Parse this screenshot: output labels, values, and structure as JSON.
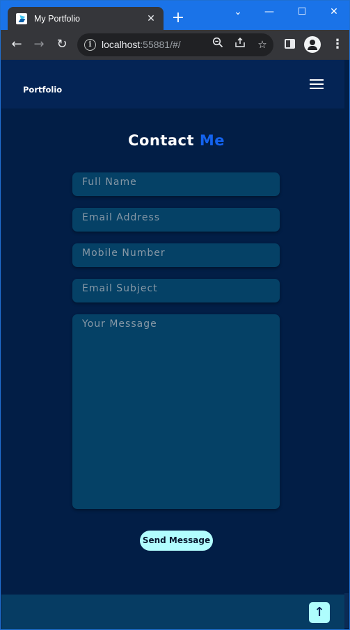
{
  "browser": {
    "tab_title": "My Portfolio",
    "tab_close": "✕",
    "new_tab": "+",
    "window_controls": {
      "dropdown": "⌄",
      "minimize": "—",
      "maximize": "☐",
      "close": "✕"
    },
    "url_host": "localhost",
    "url_rest": ":55881/#/",
    "nav": {
      "back": "←",
      "forward": "→",
      "reload": "↻"
    },
    "icons": {
      "zoom": "zoom-icon",
      "share": "share-icon",
      "bookmark": "star-icon",
      "side_panel": "side-panel-icon",
      "profile": "profile-icon",
      "menu": "kebab-menu-icon"
    }
  },
  "navbar": {
    "brand": "Portfolio"
  },
  "contact": {
    "heading_white": "Contact ",
    "heading_blue": "Me",
    "fields": {
      "full_name": "Full Name",
      "email": "Email Address",
      "mobile": "Mobile Number",
      "subject": "Email Subject",
      "message": "Your Message"
    },
    "send_button": "Send Message"
  },
  "footer": {
    "scroll_top": "↑"
  },
  "colors": {
    "page_bg": "#021e46",
    "navbar_bg": "#042455",
    "field_bg": "#054166",
    "accent_blue": "#1463ee",
    "button_bg": "#b1fdfe",
    "footer_bg": "#063c63",
    "titlebar": "#1a73e8"
  }
}
